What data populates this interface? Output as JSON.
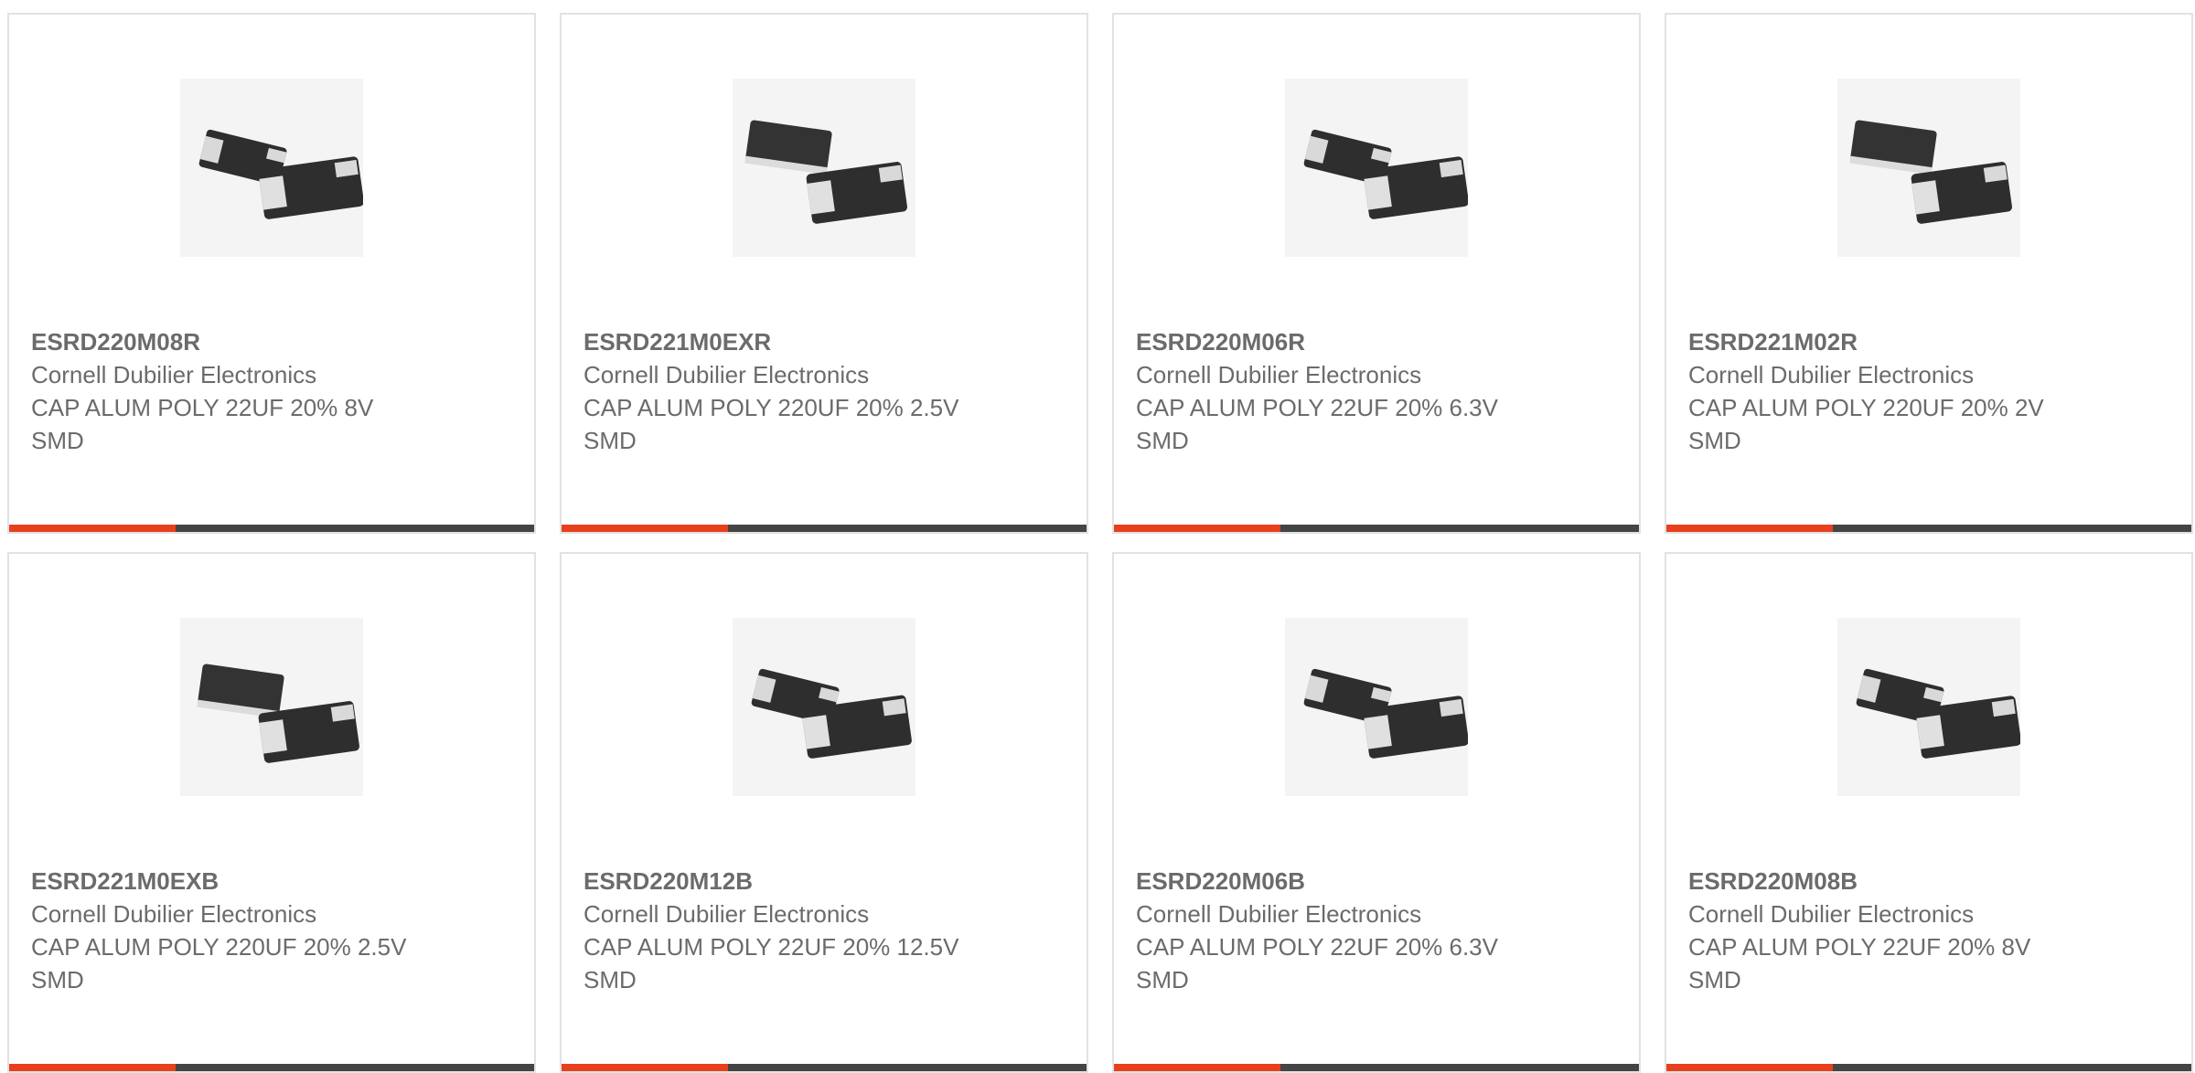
{
  "colors": {
    "accent": "#e8401c",
    "bar": "#444444",
    "border": "#e2e2e2",
    "text": "#6b6b6b"
  },
  "products": [
    {
      "part": "ESRD220M08R",
      "manufacturer": "Cornell Dubilier Electronics",
      "description": "CAP ALUM POLY 22UF 20% 8V SMD",
      "image_icon": "smd-capacitor-pair-icon"
    },
    {
      "part": "ESRD221M0EXR",
      "manufacturer": "Cornell Dubilier Electronics",
      "description": "CAP ALUM POLY 220UF 20% 2.5V SMD",
      "image_icon": "smd-capacitor-pair-icon"
    },
    {
      "part": "ESRD220M06R",
      "manufacturer": "Cornell Dubilier Electronics",
      "description": "CAP ALUM POLY 22UF 20% 6.3V SMD",
      "image_icon": "smd-capacitor-pair-icon"
    },
    {
      "part": "ESRD221M02R",
      "manufacturer": "Cornell Dubilier Electronics",
      "description": "CAP ALUM POLY 220UF 20% 2V SMD",
      "image_icon": "smd-capacitor-pair-icon"
    },
    {
      "part": "ESRD221M0EXB",
      "manufacturer": "Cornell Dubilier Electronics",
      "description": "CAP ALUM POLY 220UF 20% 2.5V SMD",
      "image_icon": "smd-capacitor-pair-icon"
    },
    {
      "part": "ESRD220M12B",
      "manufacturer": "Cornell Dubilier Electronics",
      "description": "CAP ALUM POLY 22UF 20% 12.5V SMD",
      "image_icon": "smd-capacitor-pair-icon"
    },
    {
      "part": "ESRD220M06B",
      "manufacturer": "Cornell Dubilier Electronics",
      "description": "CAP ALUM POLY 22UF 20% 6.3V SMD",
      "image_icon": "smd-capacitor-pair-icon"
    },
    {
      "part": "ESRD220M08B",
      "manufacturer": "Cornell Dubilier Electronics",
      "description": "CAP ALUM POLY 22UF 20% 8V SMD",
      "image_icon": "smd-capacitor-pair-icon"
    }
  ]
}
